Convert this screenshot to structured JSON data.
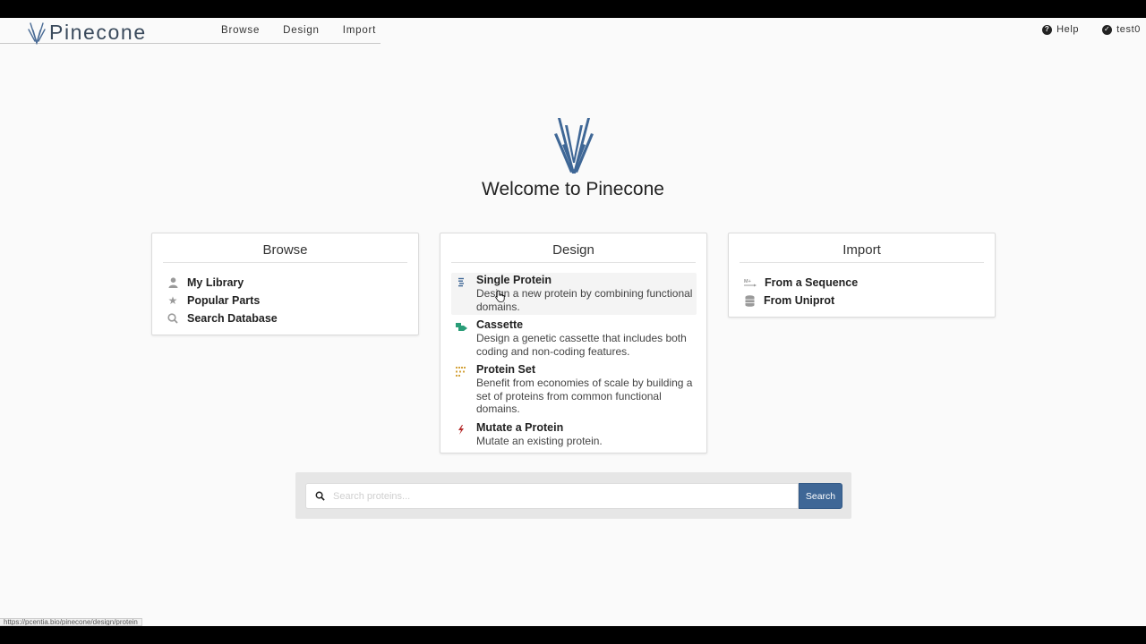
{
  "app": {
    "name": "Pinecone",
    "brand_color": "#3f6796"
  },
  "nav": {
    "links": [
      "Browse",
      "Design",
      "Import"
    ],
    "help_label": "Help",
    "user_label": "test0"
  },
  "hero": {
    "welcome": "Welcome to Pinecone"
  },
  "browse": {
    "title": "Browse",
    "items": [
      {
        "label": "My Library",
        "icon": "user-icon"
      },
      {
        "label": "Popular Parts",
        "icon": "star-icon"
      },
      {
        "label": "Search Database",
        "icon": "search-icon"
      }
    ]
  },
  "design": {
    "title": "Design",
    "items": [
      {
        "title": "Single Protein",
        "desc": "Design a new protein by combining functional domains.",
        "icon": "protein-icon"
      },
      {
        "title": "Cassette",
        "desc": "Design a genetic cassette that includes both coding and non-coding features.",
        "icon": "cassette-icon"
      },
      {
        "title": "Protein Set",
        "desc": "Benefit from economies of scale by building a set of proteins from common functional domains.",
        "icon": "protein-set-icon"
      },
      {
        "title": "Mutate a Protein",
        "desc": "Mutate an existing protein.",
        "icon": "bolt-icon"
      }
    ]
  },
  "import": {
    "title": "Import",
    "items": [
      {
        "label": "From a Sequence",
        "icon": "sequence-icon"
      },
      {
        "label": "From Uniprot",
        "icon": "database-icon"
      }
    ]
  },
  "search": {
    "placeholder": "Search proteins...",
    "button_label": "Search"
  },
  "status_bar": {
    "url": "https://pcentia.bio/pinecone/design/protein"
  }
}
